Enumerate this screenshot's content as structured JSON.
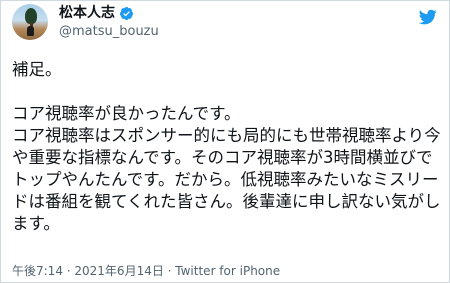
{
  "user": {
    "display_name": "松本人志",
    "handle": "@matsu_bouzu",
    "verified": true,
    "verified_color": "#1d9bf0"
  },
  "header": {
    "platform_icon": "twitter-icon",
    "platform_color": "#1d9bf0"
  },
  "tweet": {
    "text": "補足。\n\nコア視聴率が良かったんです。\nコア視聴率はスポンサー的にも局的にも世帯視聴率より今や重要な指標なんです。そのコア視聴率が3時間横並びでトップやんたんです。だから。低視聴率みたいなミスリードは番組を観てくれた皆さん。後輩達に申し訳ない気がします。"
  },
  "meta": {
    "timestamp": "午後7:14 · 2021年6月14日 · Twitter for iPhone"
  }
}
